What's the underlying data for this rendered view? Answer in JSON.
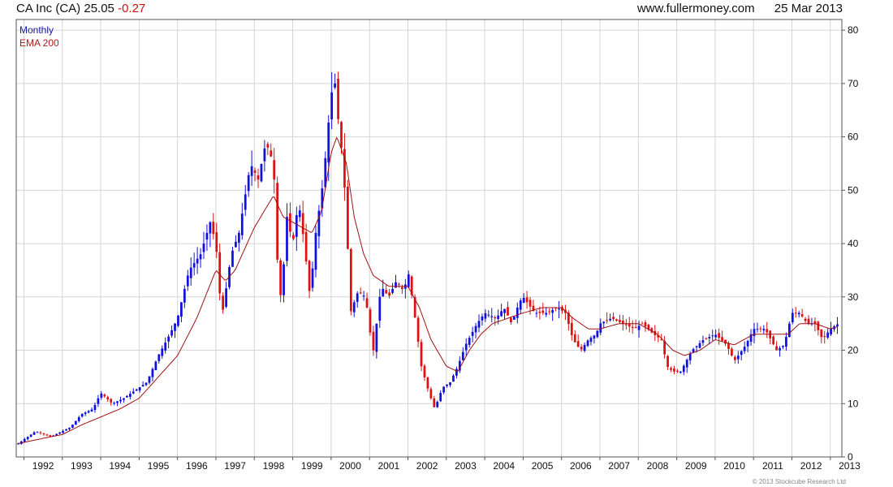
{
  "header": {
    "company": "CA Inc (CA)",
    "price": "25.05",
    "change": "-0.27",
    "site": "www.fullermoney.com",
    "date": "25 Mar 2013"
  },
  "footer": {
    "copyright": "© 2013 Stockcube Research Ltd"
  },
  "chart_data": {
    "type": "candlestick",
    "legend": [
      {
        "label": "Monthly",
        "color": "#1a1aa0"
      },
      {
        "label": "EMA 200",
        "color": "#b01818"
      }
    ],
    "colors": {
      "up": "#1111dd",
      "down": "#dd1111",
      "ema": "#a01010",
      "grid": "#d4d4d4"
    },
    "x_tick_labels": [
      "1992",
      "1993",
      "1994",
      "1995",
      "1996",
      "1997",
      "1998",
      "1999",
      "2000",
      "2001",
      "2002",
      "2003",
      "2004",
      "2005",
      "2006",
      "2007",
      "2008",
      "2009",
      "2010",
      "2011",
      "2012",
      "2013"
    ],
    "y_ticks": [
      0,
      10,
      20,
      30,
      40,
      50,
      60,
      70,
      80
    ],
    "ylim": [
      0,
      82
    ],
    "xlim": [
      1991.8,
      2013.3
    ],
    "y_axis_side": "right",
    "grid": true,
    "price_key_points": [
      [
        1991.85,
        2.5
      ],
      [
        1992.3,
        4.8
      ],
      [
        1992.7,
        3.8
      ],
      [
        1993.2,
        5.5
      ],
      [
        1993.5,
        8
      ],
      [
        1993.8,
        9
      ],
      [
        1994.0,
        12
      ],
      [
        1994.3,
        10
      ],
      [
        1994.6,
        11
      ],
      [
        1994.9,
        12.5
      ],
      [
        1995.2,
        14
      ],
      [
        1995.5,
        19
      ],
      [
        1995.8,
        23
      ],
      [
        1996.0,
        26
      ],
      [
        1996.3,
        35
      ],
      [
        1996.6,
        38
      ],
      [
        1996.85,
        44
      ],
      [
        1997.0,
        40
      ],
      [
        1997.15,
        26
      ],
      [
        1997.4,
        38
      ],
      [
        1997.6,
        42
      ],
      [
        1997.9,
        55
      ],
      [
        1998.1,
        52
      ],
      [
        1998.3,
        59
      ],
      [
        1998.5,
        55
      ],
      [
        1998.6,
        37
      ],
      [
        1998.7,
        29
      ],
      [
        1998.85,
        45
      ],
      [
        1999.0,
        40
      ],
      [
        1999.15,
        48
      ],
      [
        1999.3,
        40
      ],
      [
        1999.45,
        30
      ],
      [
        1999.6,
        42
      ],
      [
        1999.8,
        52
      ],
      [
        2000.0,
        68
      ],
      [
        2000.1,
        70
      ],
      [
        2000.2,
        62
      ],
      [
        2000.3,
        56
      ],
      [
        2000.4,
        45
      ],
      [
        2000.5,
        27
      ],
      [
        2000.7,
        31
      ],
      [
        2000.9,
        30
      ],
      [
        2001.0,
        24
      ],
      [
        2001.1,
        20
      ],
      [
        2001.3,
        32
      ],
      [
        2001.5,
        30
      ],
      [
        2001.7,
        33
      ],
      [
        2001.9,
        31
      ],
      [
        2002.0,
        35
      ],
      [
        2002.15,
        28
      ],
      [
        2002.35,
        17
      ],
      [
        2002.55,
        12
      ],
      [
        2002.7,
        9
      ],
      [
        2002.9,
        13
      ],
      [
        2003.1,
        14
      ],
      [
        2003.3,
        17
      ],
      [
        2003.5,
        21
      ],
      [
        2003.8,
        25
      ],
      [
        2004.0,
        27
      ],
      [
        2004.3,
        26
      ],
      [
        2004.5,
        28
      ],
      [
        2004.7,
        25
      ],
      [
        2004.9,
        29
      ],
      [
        2005.0,
        30
      ],
      [
        2005.3,
        27
      ],
      [
        2005.6,
        27
      ],
      [
        2005.9,
        28
      ],
      [
        2006.1,
        27
      ],
      [
        2006.3,
        22
      ],
      [
        2006.5,
        20
      ],
      [
        2006.7,
        22
      ],
      [
        2006.9,
        23
      ],
      [
        2007.0,
        25
      ],
      [
        2007.3,
        26
      ],
      [
        2007.6,
        25
      ],
      [
        2007.9,
        24
      ],
      [
        2008.1,
        25
      ],
      [
        2008.4,
        23
      ],
      [
        2008.6,
        22
      ],
      [
        2008.75,
        17
      ],
      [
        2008.9,
        16
      ],
      [
        2009.1,
        16
      ],
      [
        2009.4,
        20
      ],
      [
        2009.7,
        22
      ],
      [
        2010.0,
        23
      ],
      [
        2010.3,
        21
      ],
      [
        2010.5,
        18
      ],
      [
        2010.8,
        21
      ],
      [
        2011.0,
        24
      ],
      [
        2011.3,
        24
      ],
      [
        2011.6,
        20
      ],
      [
        2011.8,
        21
      ],
      [
        2012.0,
        27
      ],
      [
        2012.2,
        27
      ],
      [
        2012.4,
        25
      ],
      [
        2012.6,
        25
      ],
      [
        2012.8,
        22
      ],
      [
        2013.0,
        24
      ],
      [
        2013.22,
        25.05
      ]
    ],
    "ema_key_points": [
      [
        1991.85,
        2.5
      ],
      [
        1992.5,
        3.5
      ],
      [
        1993.0,
        4.2
      ],
      [
        1993.5,
        6
      ],
      [
        1994.0,
        7.5
      ],
      [
        1994.5,
        9
      ],
      [
        1995.0,
        11
      ],
      [
        1995.5,
        15
      ],
      [
        1996.0,
        19
      ],
      [
        1996.5,
        26
      ],
      [
        1997.0,
        35
      ],
      [
        1997.25,
        33
      ],
      [
        1997.5,
        35
      ],
      [
        1998.0,
        43
      ],
      [
        1998.5,
        49
      ],
      [
        1998.75,
        45
      ],
      [
        1999.0,
        44
      ],
      [
        1999.5,
        42
      ],
      [
        1999.75,
        46
      ],
      [
        2000.0,
        57
      ],
      [
        2000.15,
        60
      ],
      [
        2000.4,
        55
      ],
      [
        2000.6,
        45
      ],
      [
        2000.85,
        38
      ],
      [
        2001.1,
        34
      ],
      [
        2001.5,
        32
      ],
      [
        2002.0,
        32
      ],
      [
        2002.3,
        28
      ],
      [
        2002.6,
        22
      ],
      [
        2003.0,
        17
      ],
      [
        2003.3,
        16
      ],
      [
        2003.6,
        20
      ],
      [
        2003.9,
        23
      ],
      [
        2004.2,
        25
      ],
      [
        2004.6,
        26
      ],
      [
        2005.0,
        27
      ],
      [
        2005.5,
        28
      ],
      [
        2006.0,
        28
      ],
      [
        2006.3,
        26
      ],
      [
        2006.7,
        24
      ],
      [
        2007.0,
        24
      ],
      [
        2007.5,
        25
      ],
      [
        2008.0,
        25
      ],
      [
        2008.5,
        23
      ],
      [
        2008.9,
        20
      ],
      [
        2009.2,
        19
      ],
      [
        2009.6,
        20
      ],
      [
        2010.0,
        22
      ],
      [
        2010.5,
        21
      ],
      [
        2011.0,
        23
      ],
      [
        2011.5,
        23
      ],
      [
        2011.9,
        23
      ],
      [
        2012.2,
        25
      ],
      [
        2012.6,
        25
      ],
      [
        2013.0,
        24
      ],
      [
        2013.22,
        24.5
      ]
    ]
  }
}
